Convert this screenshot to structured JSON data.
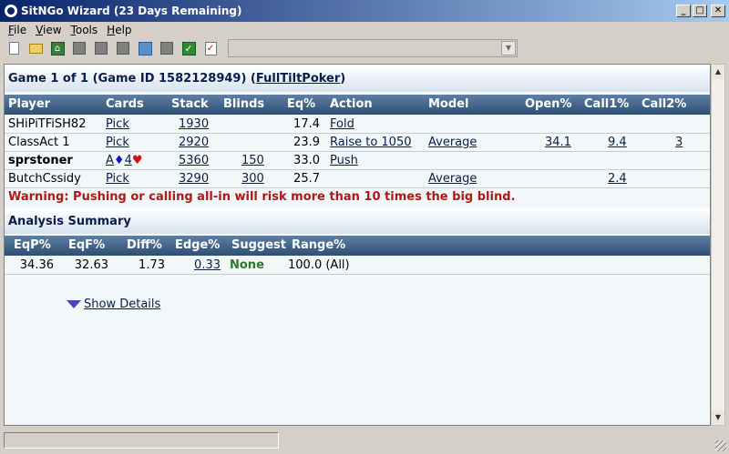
{
  "window": {
    "title": "SitNGo Wizard (23 Days Remaining)"
  },
  "menu": [
    {
      "label": "File",
      "u": "F",
      "rest": "ile"
    },
    {
      "label": "View",
      "u": "V",
      "rest": "iew"
    },
    {
      "label": "Tools",
      "u": "T",
      "rest": "ools"
    },
    {
      "label": "Help",
      "u": "H",
      "rest": "elp"
    }
  ],
  "game": {
    "title_prefix": "Game 1 of 1 (Game ID 1582128949) (",
    "site_link": "FullTiltPoker ",
    "title_suffix": ")"
  },
  "table": {
    "headers": [
      "Player",
      "Cards",
      "Stack",
      "Blinds",
      "Eq%",
      "Action",
      "Model",
      "Open%",
      "Call1%",
      "Call2%"
    ],
    "rows": [
      {
        "player": "SHiPiTFiSH82",
        "cards": "Pick",
        "stack": "1930",
        "blinds": "",
        "eq": "17.4",
        "action": "Fold",
        "model": "",
        "open": "",
        "call1": "",
        "call2": ""
      },
      {
        "player": "ClassAct 1",
        "cards": "Pick",
        "stack": "2920",
        "blinds": "",
        "eq": "23.9",
        "action": "Raise to 1050",
        "model": "Average",
        "open": "34.1",
        "call1": "9.4",
        "call2": "3"
      },
      {
        "player": "sprstoner",
        "cards_rank1": "A",
        "cards_suit1": "♦",
        "cards_rank2": "4",
        "cards_suit2": "♥",
        "stack": "5360",
        "blinds": "150",
        "eq": "33.0",
        "action": "Push",
        "model": "",
        "open": "",
        "call1": "",
        "call2": ""
      },
      {
        "player": "ButchCssidy",
        "cards": "Pick",
        "stack": "3290",
        "blinds": "300",
        "eq": "25.7",
        "action": "",
        "model": "Average",
        "open": "",
        "call1": "2.4",
        "call2": ""
      }
    ]
  },
  "warning": "Warning: Pushing or calling all-in will risk more than 10 times the big blind.",
  "summary": {
    "title": "Analysis Summary",
    "headers": [
      "EqP%",
      "EqF%",
      "Diff%",
      "Edge%",
      "Suggest",
      "Range%"
    ],
    "row": {
      "eqp": "34.36",
      "eqf": "32.63",
      "diff": "1.73",
      "edge": "0.33",
      "suggest": "None",
      "range": "100.0 (All)"
    }
  },
  "details_link": " Show Details",
  "colors": {
    "header_dark": "#2e4f74",
    "warning": "#b01818",
    "suggest_none": "#2a7a2a"
  }
}
